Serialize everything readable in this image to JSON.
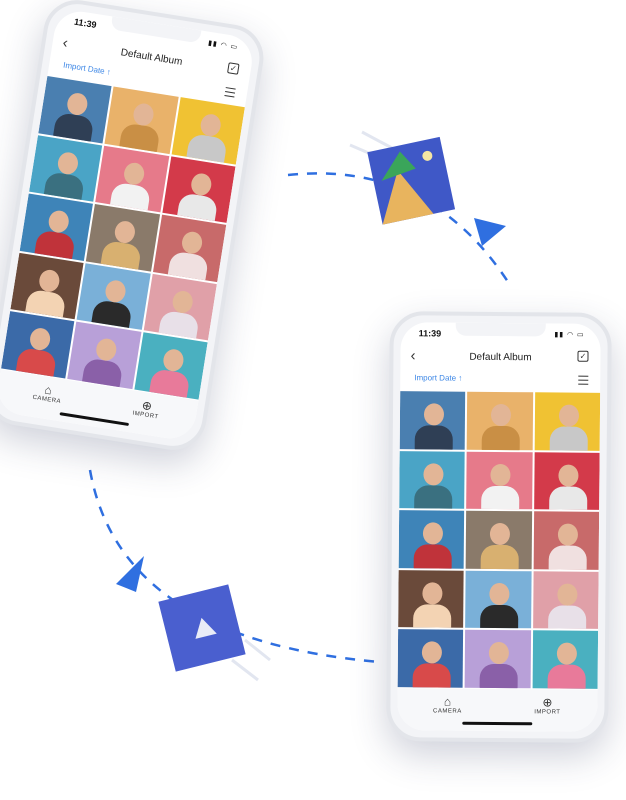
{
  "colors": {
    "accent": "#3d87e6",
    "arrow": "#2f6fe0",
    "tile_blue": "#3f58c7"
  },
  "phone": {
    "time": "11:39",
    "title": "Default Album",
    "back_icon": "chevron-left-icon",
    "select_icon": "checkbox-icon",
    "sort_label": "Import Date ↑",
    "view_icon": "list-icon",
    "tabs": [
      {
        "icon": "camera-icon",
        "glyph": "⌂",
        "label": "CAMERA"
      },
      {
        "icon": "plus-circle-icon",
        "glyph": "⊕",
        "label": "IMPORT"
      }
    ]
  },
  "photos": [
    {
      "bg": "#4a7fb0",
      "shirt": "#2f3f55"
    },
    {
      "bg": "#e9b26a",
      "shirt": "#c98f45"
    },
    {
      "bg": "#f0c233",
      "shirt": "#c8c8c8"
    },
    {
      "bg": "#4aa4c6",
      "shirt": "#3a7080"
    },
    {
      "bg": "#e67a8a",
      "shirt": "#f2f2f2"
    },
    {
      "bg": "#d33a4a",
      "shirt": "#e8e8e8"
    },
    {
      "bg": "#3e84b8",
      "shirt": "#c0333a"
    },
    {
      "bg": "#8a7a6a",
      "shirt": "#d8b070"
    },
    {
      "bg": "#c86a6a",
      "shirt": "#f0e0e0"
    },
    {
      "bg": "#6a4a3a",
      "shirt": "#f3d3b3"
    },
    {
      "bg": "#7ab0d8",
      "shirt": "#2a2a2a"
    },
    {
      "bg": "#e0a0a8",
      "shirt": "#e8e0e8"
    },
    {
      "bg": "#3b6aa8",
      "shirt": "#d84a4a"
    },
    {
      "bg": "#b8a0d8",
      "shirt": "#8a60a8"
    },
    {
      "bg": "#4ab0c0",
      "shirt": "#e87a9a"
    }
  ],
  "decor": {
    "image_tile_icon": "image-file-icon",
    "play_tile_icon": "play-file-icon",
    "arrow_icon": "arrowhead-icon"
  }
}
